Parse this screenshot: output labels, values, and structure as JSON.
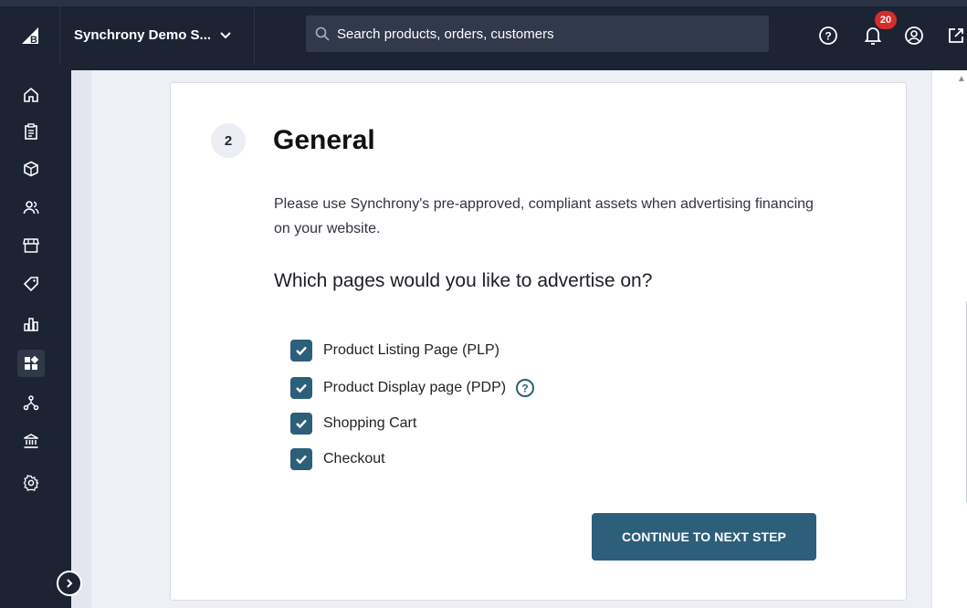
{
  "topbar": {
    "store_name": "Synchrony Demo S...",
    "search_placeholder": "Search products, orders, customers",
    "notification_count": "20",
    "icons": [
      "help-icon",
      "bell-icon",
      "account-icon",
      "external-link-icon"
    ]
  },
  "sidebar": {
    "items": [
      {
        "name": "home-icon"
      },
      {
        "name": "orders-icon"
      },
      {
        "name": "products-icon"
      },
      {
        "name": "customers-icon"
      },
      {
        "name": "storefront-icon"
      },
      {
        "name": "marketing-icon"
      },
      {
        "name": "analytics-icon"
      },
      {
        "name": "apps-icon",
        "active": true
      },
      {
        "name": "channels-icon"
      },
      {
        "name": "bank-icon"
      },
      {
        "name": "settings-icon"
      }
    ]
  },
  "main": {
    "step_number": "2",
    "title": "General",
    "description": "Please use Synchrony's pre-approved, compliant assets when advertising financing on your website.",
    "question": "Which pages would you like to advertise on?",
    "options": [
      {
        "label": "Product Listing Page (PLP)",
        "checked": true
      },
      {
        "label": "Product Display page (PDP)",
        "checked": true,
        "help": true
      },
      {
        "label": "Shopping Cart",
        "checked": true
      },
      {
        "label": "Checkout",
        "checked": true
      }
    ],
    "continue_label": "CONTINUE TO NEXT STEP"
  },
  "colors": {
    "topbar_bg": "#1c2434",
    "accent": "#2d5f7a",
    "badge": "#d62c2c"
  }
}
